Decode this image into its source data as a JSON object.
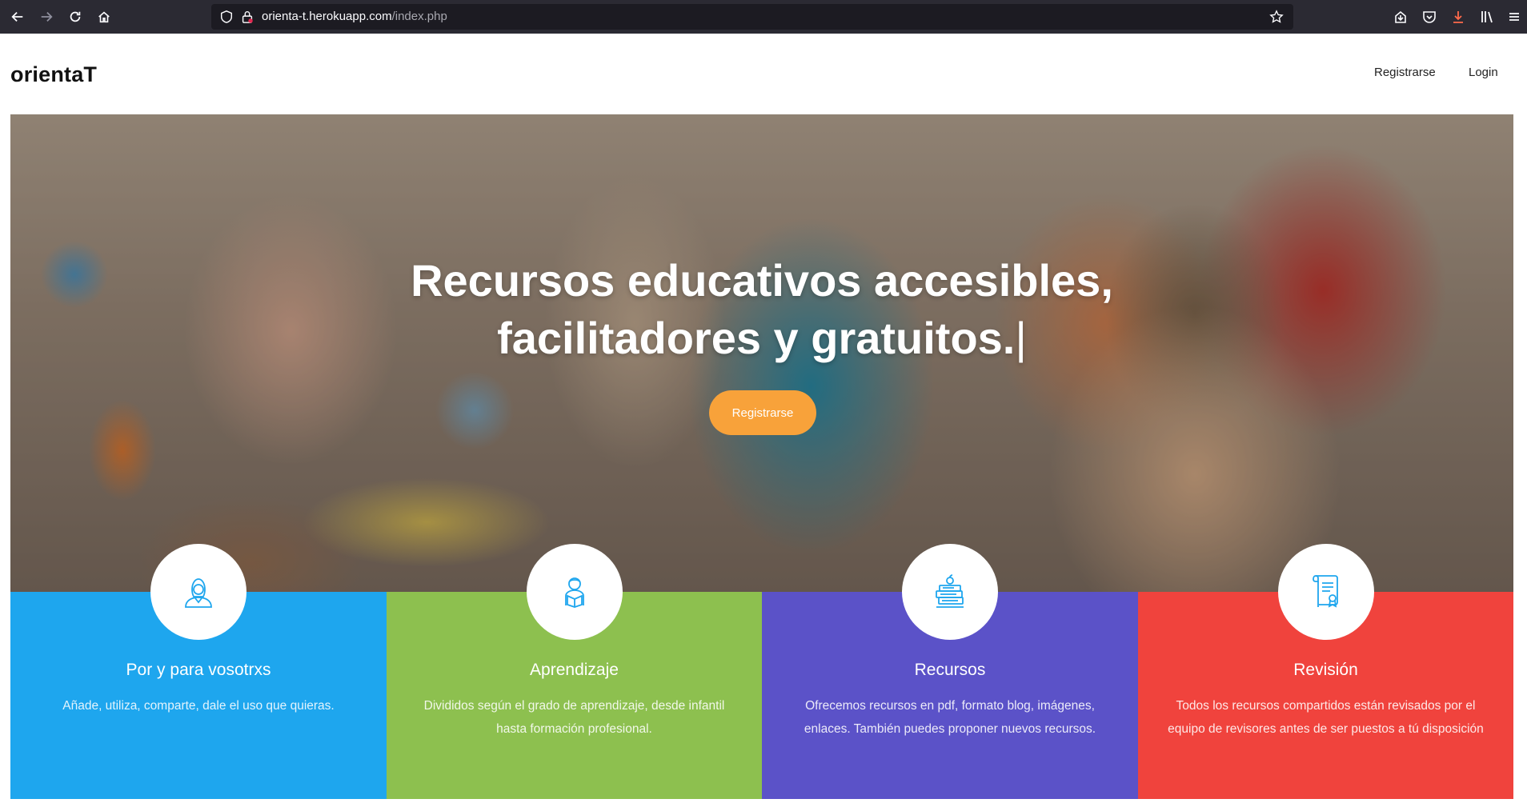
{
  "browser": {
    "url_host": "orienta-t.herokuapp.com",
    "url_path": "/index.php"
  },
  "header": {
    "brand": "orientaT",
    "nav": {
      "register": "Registrarse",
      "login": "Login"
    }
  },
  "hero": {
    "title_line1": "Recursos educativos accesibles,",
    "title_line2": "facilitadores y gratuitos.",
    "cursor": "|",
    "cta_label": "Registrarse",
    "cta_color": "#f8a23a"
  },
  "features": [
    {
      "title": "Por y para vosotrxs",
      "text": "Añade, utiliza, comparte, dale el uso que quieras.",
      "color": "#1ea6ee",
      "icon": "woman-user-icon"
    },
    {
      "title": "Aprendizaje",
      "text": "Divididos según el grado de aprendizaje, desde infantil hasta formación profesional.",
      "color": "#8dc04f",
      "icon": "student-reading-icon"
    },
    {
      "title": "Recursos",
      "text": "Ofrecemos recursos en pdf, formato blog, imágenes, enlaces. También puedes proponer nuevos recursos.",
      "color": "#5b52c8",
      "icon": "books-apple-icon"
    },
    {
      "title": "Revisión",
      "text": "Todos los recursos compartidos están revisados por el equipo de revisores antes de ser puestos a tú disposición",
      "color": "#f0433d",
      "icon": "certificate-scroll-icon"
    }
  ]
}
